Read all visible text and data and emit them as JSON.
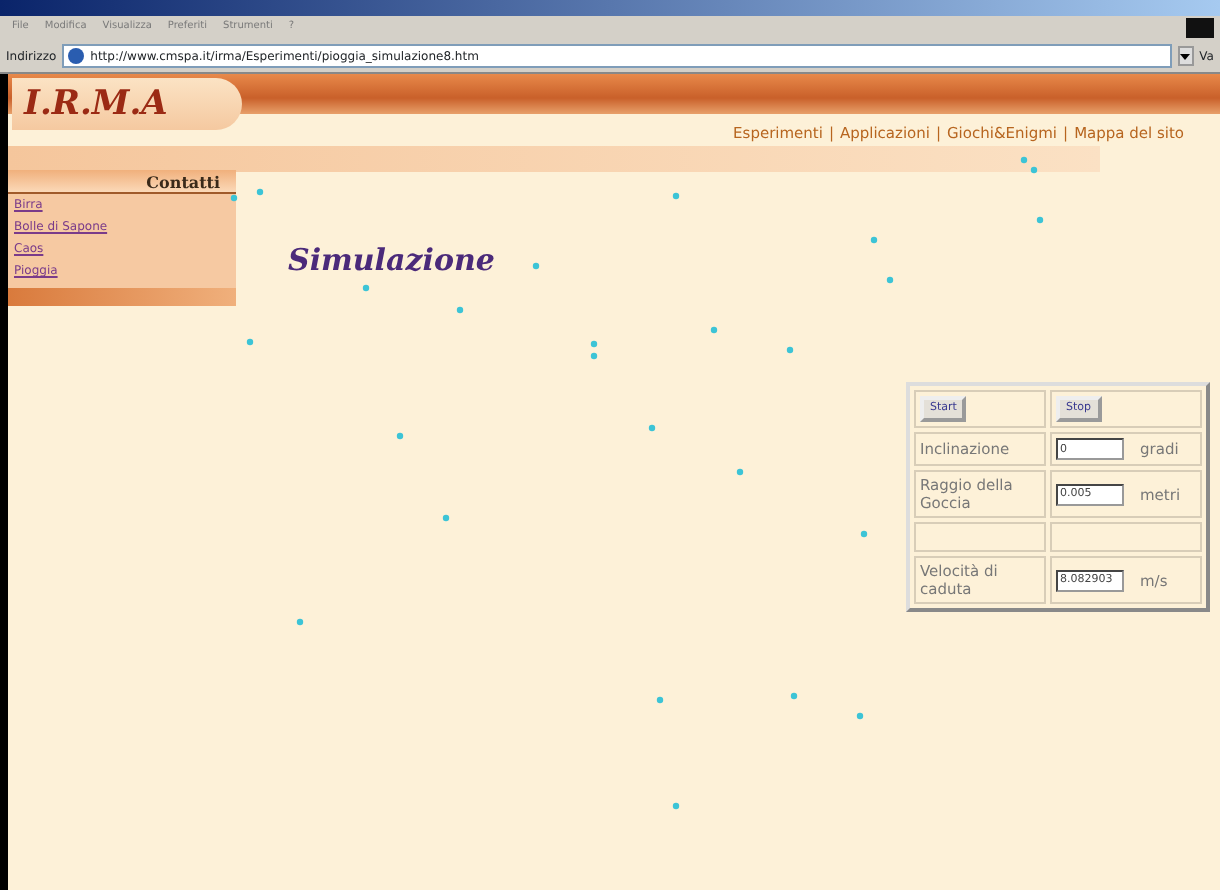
{
  "browser": {
    "menu": [
      "File",
      "Modifica",
      "Visualizza",
      "Preferiti",
      "Strumenti",
      "?"
    ],
    "address_label": "Indirizzo",
    "url": "http://www.cmspa.it/irma/Esperimenti/pioggia_simulazione8.htm",
    "go": "Va"
  },
  "site": {
    "logo": "I.R.M.A",
    "nav": [
      "Esperimenti",
      "Applicazioni",
      "Giochi&Enigmi",
      "Mappa del sito"
    ],
    "nav_separator": "|",
    "section": "Contatti",
    "sidebar": [
      "Birra",
      "Bolle di Sapone",
      "Caos",
      "Pioggia"
    ]
  },
  "title": "Simulazione",
  "panel": {
    "buttons": [
      "Start",
      "Stop"
    ],
    "rows": [
      {
        "kind": "field",
        "label": "Inclinazione",
        "value": "0",
        "unit": "gradi"
      },
      {
        "kind": "field",
        "label": "Raggio della Goccia",
        "value": "0.005",
        "unit": "metri"
      },
      {
        "kind": "blank"
      },
      {
        "kind": "field",
        "label": "Velocità di caduta",
        "value": "8.082903",
        "unit": "m/s"
      }
    ]
  }
}
